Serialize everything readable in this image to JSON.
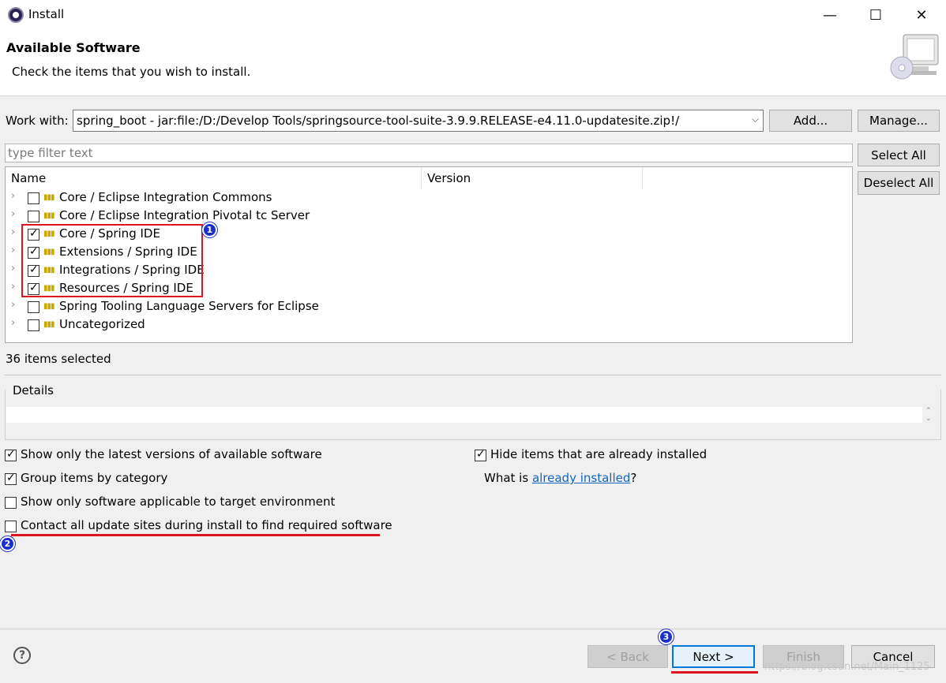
{
  "window": {
    "title": "Install",
    "minimize_glyph": "—",
    "maximize_glyph": "☐",
    "close_glyph": "✕"
  },
  "header": {
    "title": "Available Software",
    "description": "Check the items that you wish to install."
  },
  "work_with": {
    "label": "Work with:",
    "value": "spring_boot - jar:file:/D:/Develop Tools/springsource-tool-suite-3.9.9.RELEASE-e4.11.0-updatesite.zip!/",
    "add_label": "Add...",
    "manage_label": "Manage..."
  },
  "filter": {
    "placeholder": "type filter text",
    "select_all_label": "Select All",
    "deselect_all_label": "Deselect All"
  },
  "tree": {
    "columns": [
      "Name",
      "Version"
    ],
    "items": [
      {
        "label": "Core / Eclipse Integration Commons",
        "checked": false
      },
      {
        "label": "Core / Eclipse Integration Pivotal tc Server",
        "checked": false
      },
      {
        "label": "Core / Spring IDE",
        "checked": true
      },
      {
        "label": "Extensions / Spring IDE",
        "checked": true
      },
      {
        "label": "Integrations / Spring IDE",
        "checked": true
      },
      {
        "label": "Resources / Spring IDE",
        "checked": true
      },
      {
        "label": "Spring Tooling Language Servers for Eclipse",
        "checked": false
      },
      {
        "label": "Uncategorized",
        "checked": false
      }
    ]
  },
  "status": {
    "selected_count": "36 items selected"
  },
  "details": {
    "label": "Details"
  },
  "options": {
    "latest_versions": {
      "label": "Show only the latest versions of available software",
      "checked": true
    },
    "group_by_category": {
      "label": "Group items by category",
      "checked": true
    },
    "target_env": {
      "label": "Show only software applicable to target environment",
      "checked": false
    },
    "contact_sites": {
      "label": "Contact all update sites during install to find required software",
      "checked": false
    },
    "hide_installed": {
      "label": "Hide items that are already installed",
      "checked": true
    },
    "what_is_prefix": "What is ",
    "already_installed_link": "already installed",
    "what_is_suffix": "?"
  },
  "annotations": {
    "badge1": "1",
    "badge2": "2",
    "badge3": "3",
    "accent_color": "#e0141e",
    "badge_color": "#1a2fc8"
  },
  "footer": {
    "help_glyph": "?",
    "back_label": "< Back",
    "next_label": "Next >",
    "finish_label": "Finish",
    "cancel_label": "Cancel",
    "watermark": "https://blog.csdn.net/Main_1125"
  }
}
